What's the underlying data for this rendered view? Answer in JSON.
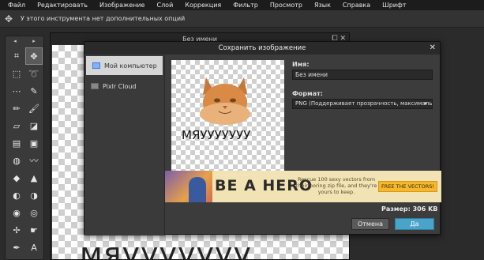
{
  "menubar": {
    "items": [
      "Файл",
      "Редактировать",
      "Изображение",
      "Слой",
      "Коррекция",
      "Фильтр",
      "Просмотр",
      "Язык",
      "Справка",
      "Шрифт"
    ]
  },
  "options_bar": {
    "tool_icon": "move-tool-icon",
    "text": "У этого инструмента нет дополнительных опций"
  },
  "toolbox": {
    "head_left": "◂",
    "head_right": "▸",
    "tools": [
      {
        "name": "crop-tool-icon",
        "glyph": "⌗"
      },
      {
        "name": "move-tool-icon",
        "glyph": "✥",
        "active": true
      },
      {
        "name": "marquee-tool-icon",
        "glyph": "⬚"
      },
      {
        "name": "lasso-tool-icon",
        "glyph": "➰"
      },
      {
        "name": "wand-tool-icon",
        "glyph": "⋯"
      },
      {
        "name": "picker-tool-icon",
        "glyph": "✎"
      },
      {
        "name": "pencil-tool-icon",
        "glyph": "✏"
      },
      {
        "name": "brush-tool-icon",
        "glyph": "🖌"
      },
      {
        "name": "eraser-tool-icon",
        "glyph": "▱"
      },
      {
        "name": "bucket-tool-icon",
        "glyph": "◪"
      },
      {
        "name": "gradient-tool-icon",
        "glyph": "▤"
      },
      {
        "name": "stamp-tool-icon",
        "glyph": "▣"
      },
      {
        "name": "drawing-tool-icon",
        "glyph": "◍"
      },
      {
        "name": "smudge-tool-icon",
        "glyph": "〰"
      },
      {
        "name": "drop-tool-icon",
        "glyph": "◆"
      },
      {
        "name": "sharpen-tool-icon",
        "glyph": "▲"
      },
      {
        "name": "dodge-tool-icon",
        "glyph": "◐"
      },
      {
        "name": "burn-tool-icon",
        "glyph": "◑"
      },
      {
        "name": "redeye-tool-icon",
        "glyph": "◉"
      },
      {
        "name": "sponge-tool-icon",
        "glyph": "◎"
      },
      {
        "name": "color-replace-tool-icon",
        "glyph": "✢"
      },
      {
        "name": "hand-tool-icon",
        "glyph": "☛"
      },
      {
        "name": "pen-tool-icon",
        "glyph": "✒"
      },
      {
        "name": "text-tool-icon",
        "glyph": "A"
      }
    ]
  },
  "document": {
    "title": "Без имени",
    "controls": "⧠ ✕",
    "canvas_text": "мяууууууу"
  },
  "dialog": {
    "title": "Сохранить изображение",
    "close_glyph": "✕",
    "locations": [
      {
        "label": "Мой компьютер",
        "selected": true
      },
      {
        "label": "Pixlr Cloud",
        "selected": false
      }
    ],
    "preview_text": "МЯУУУУУУУ",
    "name_label": "Имя:",
    "name_value": "Без имени",
    "format_label": "Формат:",
    "format_value": "PNG (Поддерживает прозрачность, максимальн",
    "format_arrow": "▾",
    "size_text": "Размер: 306 KB",
    "cancel_label": "Отмена",
    "ok_label": "Да"
  },
  "ad": {
    "headline": "BE A HERO",
    "copy": "Rescue 100 sexy vectors from their boring zip file, and they're yours to keep.",
    "button": "FREE THE VECTORS!"
  },
  "colors": {
    "ok_button": "#4aa3c9",
    "ad_button": "#f5b72b",
    "ad_bg": "#f1e3b3"
  }
}
